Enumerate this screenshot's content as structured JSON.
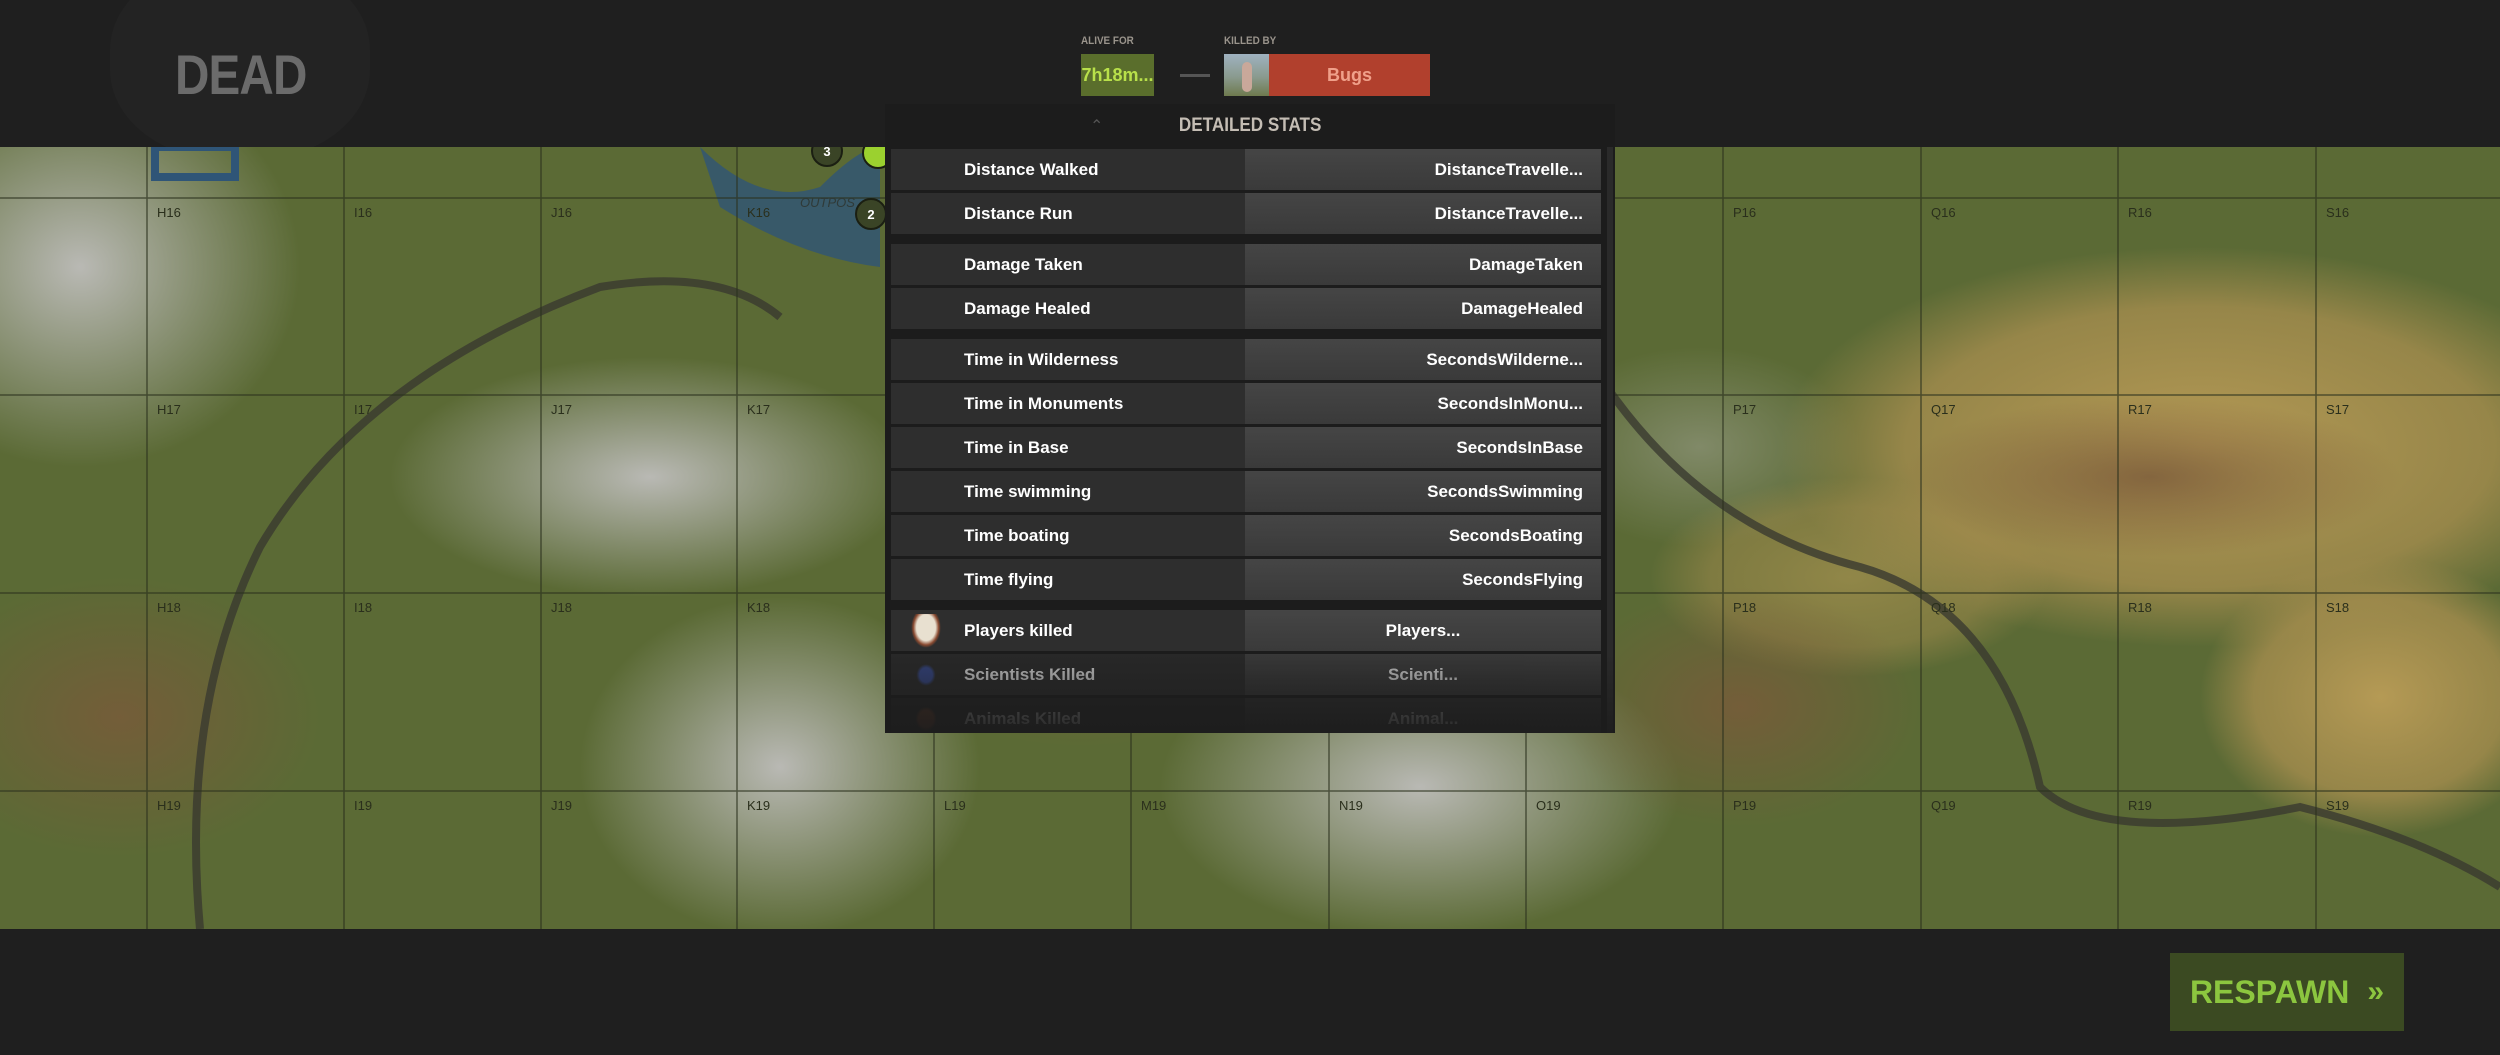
{
  "header": {
    "status_title": "DEAD",
    "alive_for_label": "ALIVE FOR",
    "alive_for_value": "7h18m...",
    "killed_by_label": "KILLED BY",
    "killer_name": "Bugs"
  },
  "map": {
    "row16": [
      "H16",
      "I16",
      "J16",
      "K16",
      "P16",
      "Q16",
      "R16",
      "S16"
    ],
    "row17": [
      "H17",
      "I17",
      "J17",
      "K17",
      "P17",
      "Q17",
      "R17",
      "S17"
    ],
    "row18": [
      "H18",
      "I18",
      "J18",
      "K18",
      "P18",
      "Q18",
      "R18",
      "S18"
    ],
    "row19": [
      "H19",
      "I19",
      "J19",
      "K19",
      "L19",
      "M19",
      "N19",
      "O19",
      "P19",
      "Q19",
      "R19",
      "S19"
    ],
    "markers": [
      "3",
      "2"
    ],
    "place_label": "OUTPOS"
  },
  "stats": {
    "title": "DETAILED STATS",
    "rows": [
      {
        "label": "Distance Walked",
        "value": "DistanceTravelle..."
      },
      {
        "label": "Distance Run",
        "value": "DistanceTravelle..."
      },
      {
        "label": "Damage Taken",
        "value": "DamageTaken"
      },
      {
        "label": "Damage Healed",
        "value": "DamageHealed"
      },
      {
        "label": "Time in Wilderness",
        "value": "SecondsWilderne..."
      },
      {
        "label": "Time in Monuments",
        "value": "SecondsInMonu..."
      },
      {
        "label": "Time in Base",
        "value": "SecondsInBase"
      },
      {
        "label": "Time swimming",
        "value": "SecondsSwimming"
      },
      {
        "label": "Time boating",
        "value": "SecondsBoating"
      },
      {
        "label": "Time flying",
        "value": "SecondsFlying"
      },
      {
        "label": "Players killed",
        "value": "Players..."
      },
      {
        "label": "Scientists Killed",
        "value": "Scienti..."
      },
      {
        "label": "Animals Killed",
        "value": "Animal..."
      }
    ]
  },
  "respawn": {
    "label": "RESPAWN",
    "icon": "double-chevron-right-icon"
  },
  "colors": {
    "alive": "#5a6e2c",
    "killer": "#b1402d",
    "respawn_bg": "#3b4a22",
    "respawn_text": "#8cc63f"
  }
}
